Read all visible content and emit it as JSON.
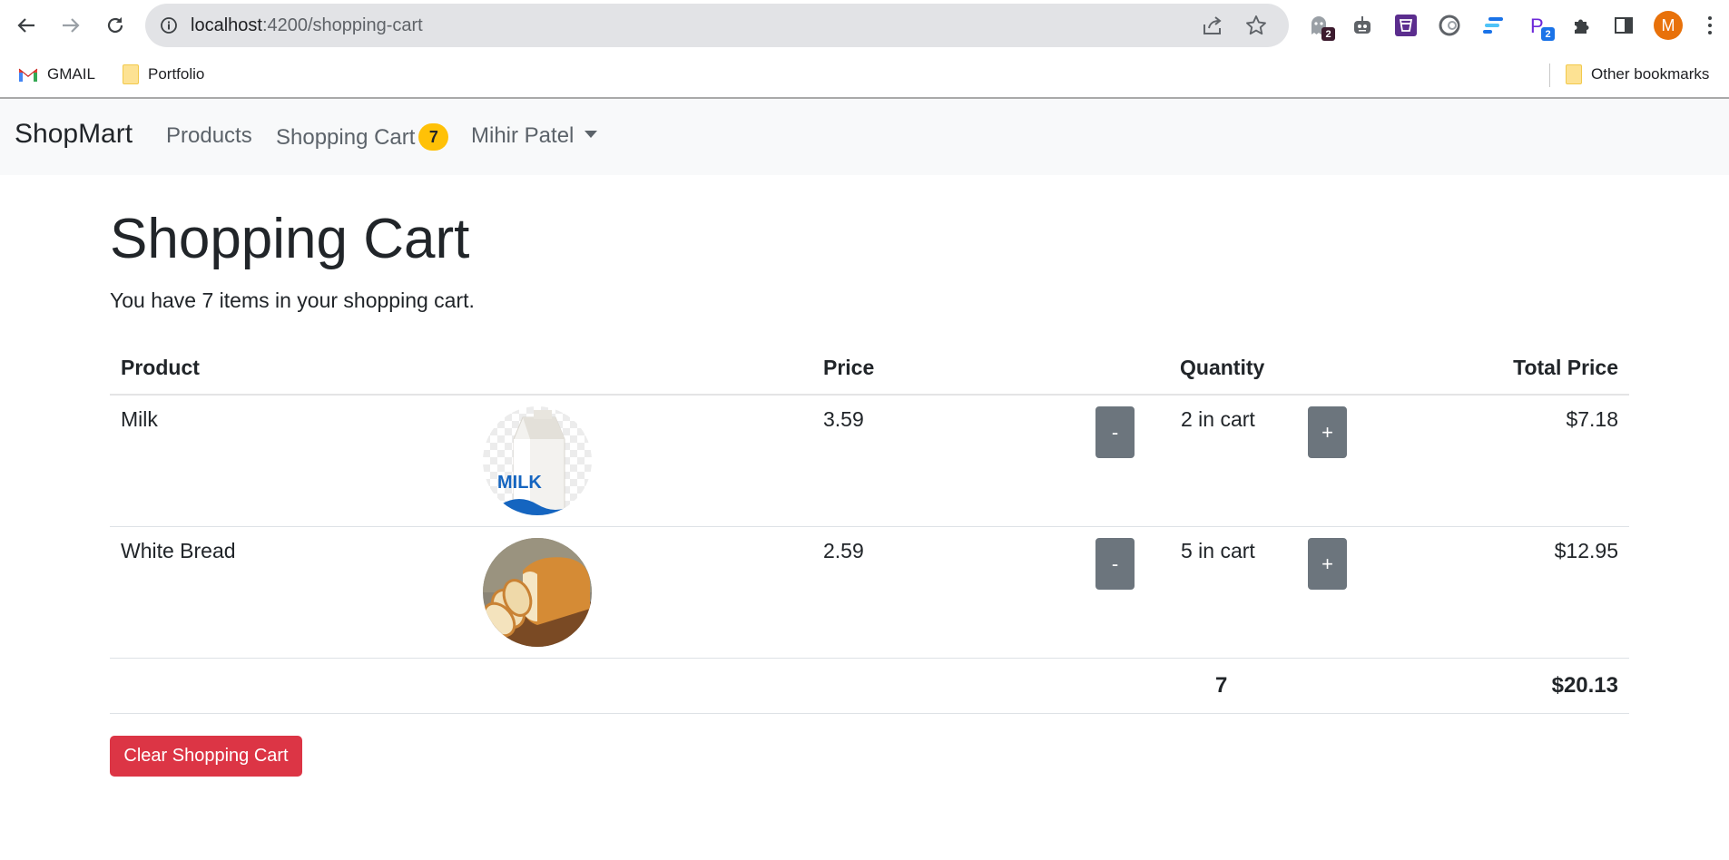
{
  "browser": {
    "url_host": "localhost",
    "url_path": ":4200/shopping-cart",
    "extensions": [
      {
        "icon": "ghost-icon",
        "badge": "2",
        "badge_color": "#3c1b2e"
      },
      {
        "icon": "robot-icon",
        "badge": ""
      },
      {
        "icon": "drink-icon",
        "badge": ""
      },
      {
        "icon": "swirl-icon",
        "badge": ""
      },
      {
        "icon": "stack-icon",
        "badge": ""
      },
      {
        "icon": "letter-p-icon",
        "badge": "2",
        "badge_color": "#1a73e8"
      },
      {
        "icon": "puzzle-icon",
        "badge": ""
      },
      {
        "icon": "sidepanel-icon",
        "badge": ""
      }
    ],
    "profile_initial": "M",
    "bookmarks": [
      {
        "label": "GMAIL",
        "icon": "gmail-icon"
      },
      {
        "label": "Portfolio",
        "icon": "folder-icon"
      }
    ],
    "other_bookmarks": "Other bookmarks"
  },
  "navbar": {
    "brand": "ShopMart",
    "products": "Products",
    "shopping_cart": "Shopping Cart",
    "cart_count": "7",
    "user": "Mihir Patel"
  },
  "page": {
    "title": "Shopping Cart",
    "subtitle": "You have 7 items in your shopping cart."
  },
  "table": {
    "headers": {
      "product": "Product",
      "price": "Price",
      "quantity": "Quantity",
      "total": "Total Price"
    },
    "rows": [
      {
        "name": "Milk",
        "image": "milk-carton-image",
        "price": "3.59",
        "minus": "-",
        "qty": "2 in cart",
        "plus": "+",
        "total": "$7.18"
      },
      {
        "name": "White Bread",
        "image": "bread-loaf-image",
        "price": "2.59",
        "minus": "-",
        "qty": "5 in cart",
        "plus": "+",
        "total": "$12.95"
      }
    ],
    "footer": {
      "qty_total": "7",
      "grand_total": "$20.13"
    }
  },
  "clear_button": "Clear Shopping Cart",
  "colors": {
    "badge": "#ffc107",
    "qty_button": "#6c757d",
    "danger": "#dc3545",
    "navbar_bg": "#f8f9fa"
  }
}
